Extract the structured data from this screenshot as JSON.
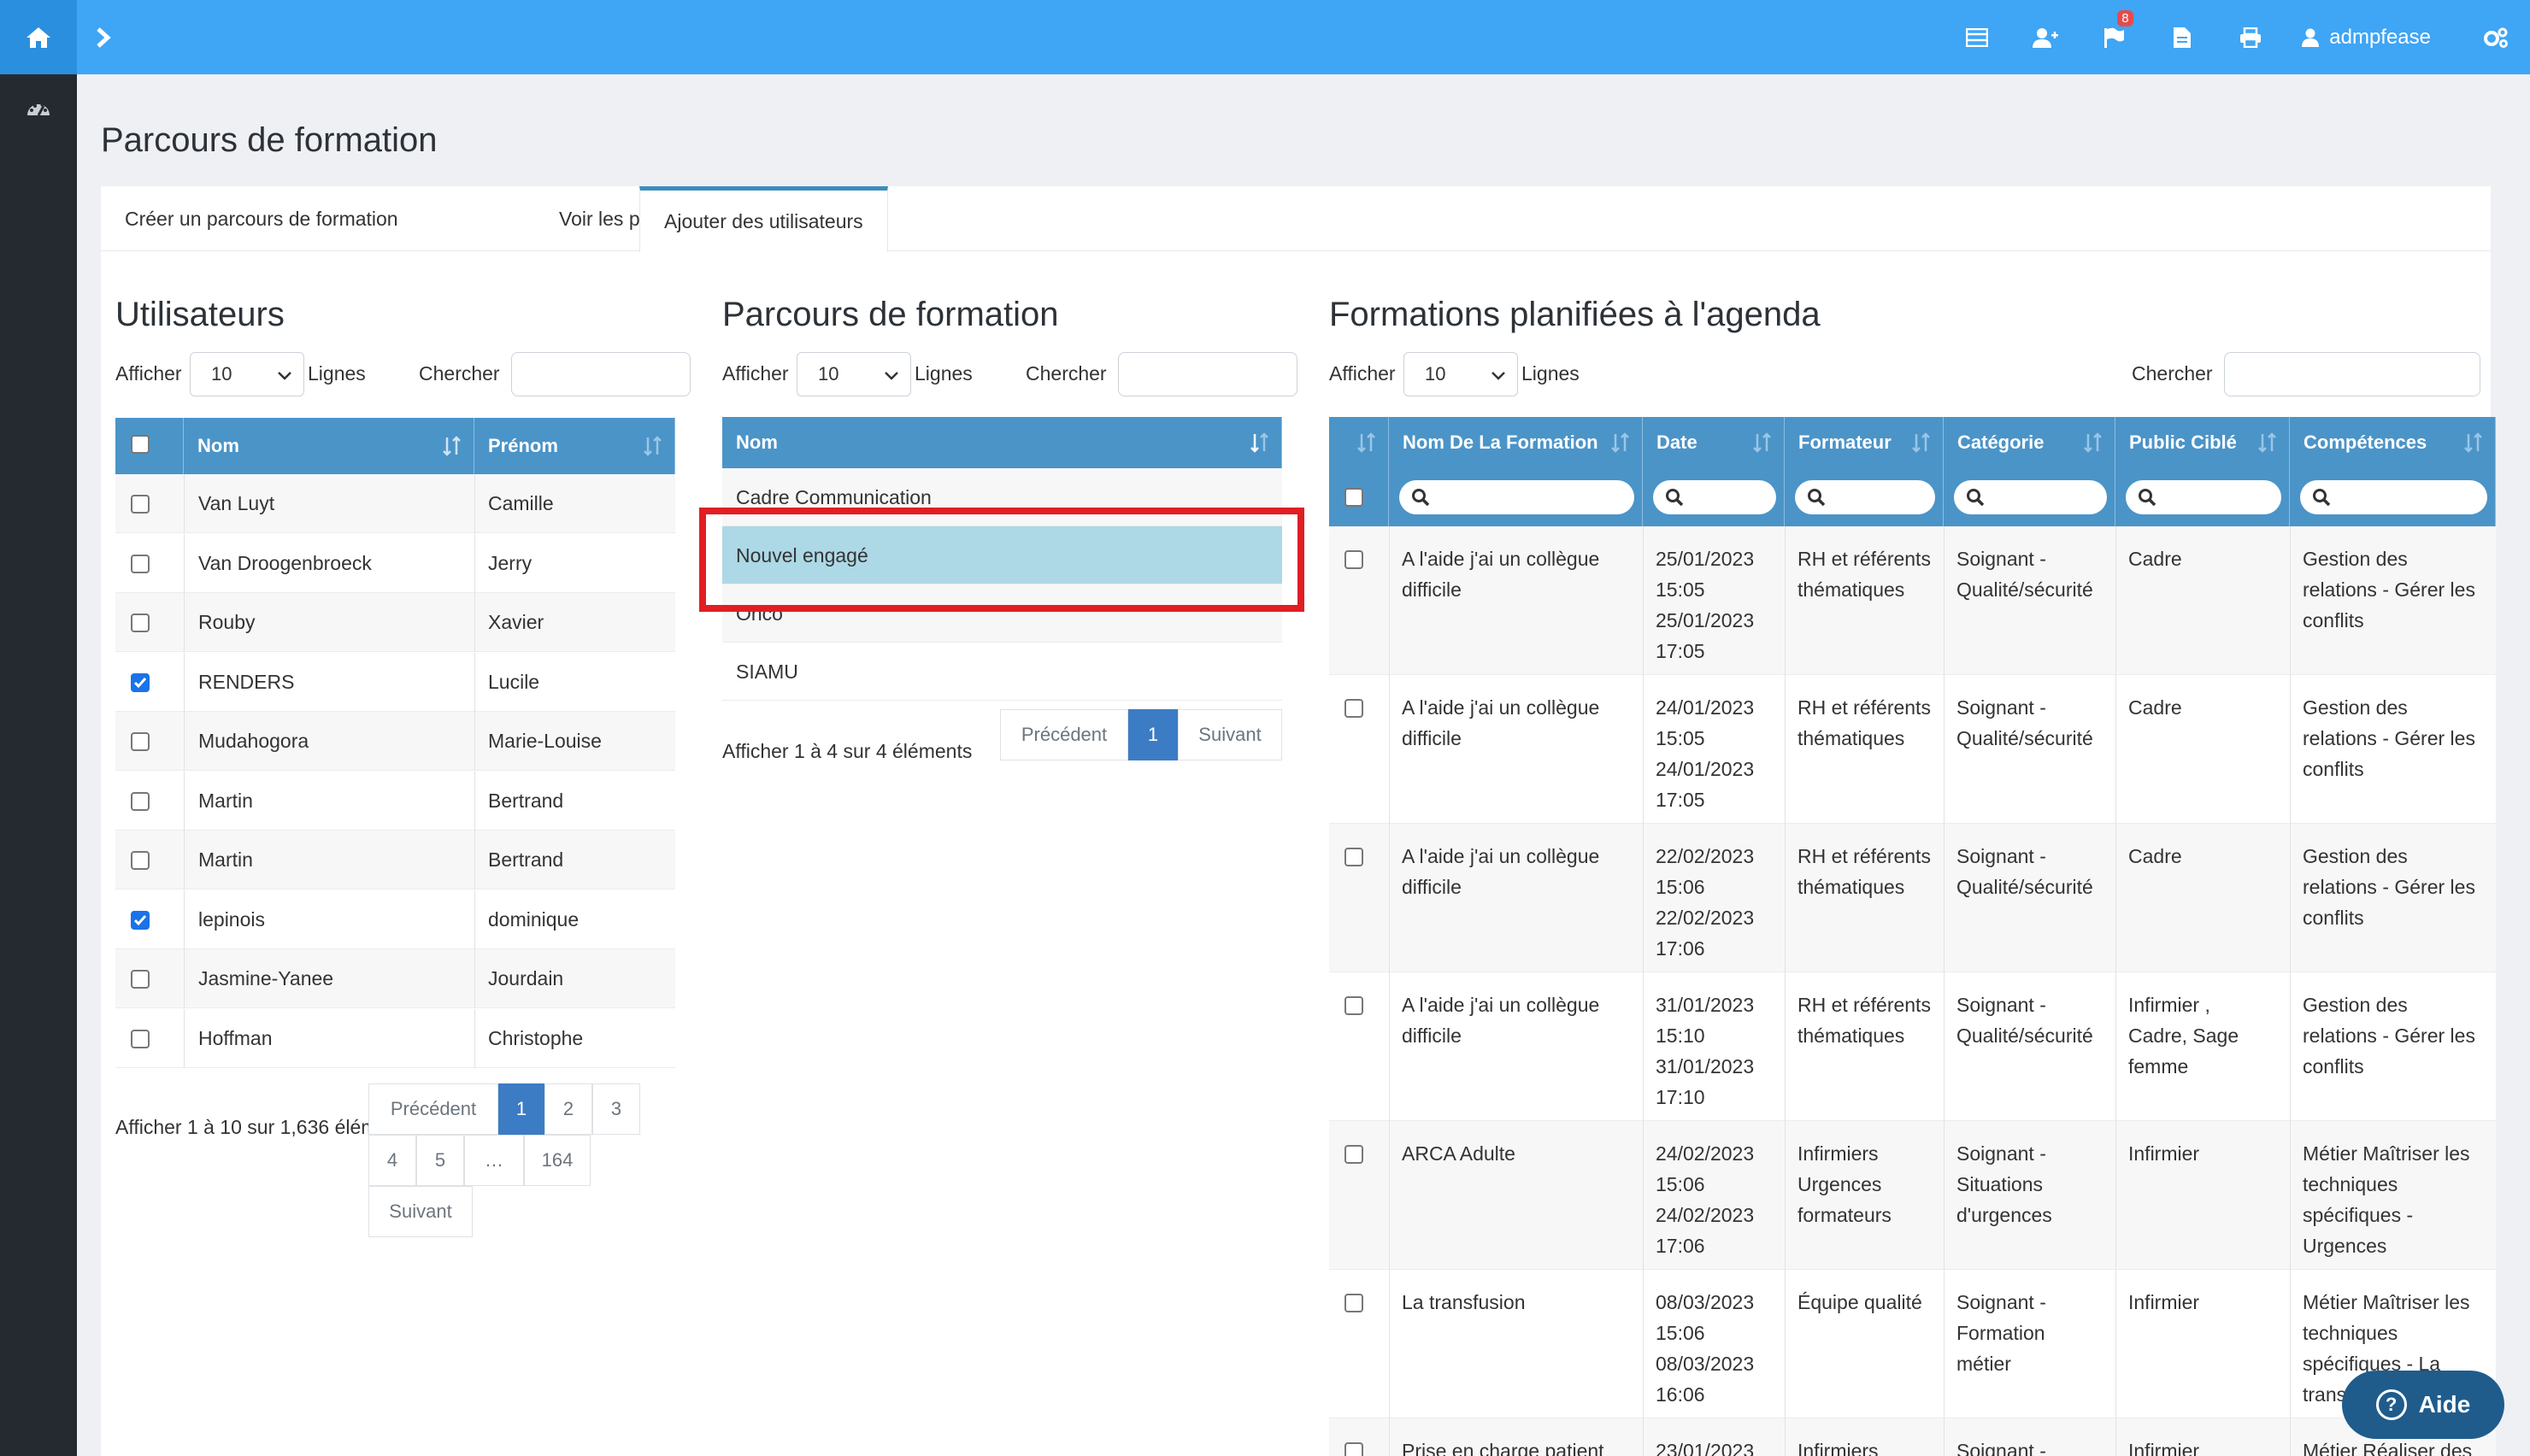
{
  "topbar": {
    "username": "admpfease",
    "notification_count": "8",
    "accent_color": "#3fa5f5",
    "icons": [
      "list-icon",
      "add-user-icon",
      "flag-icon",
      "document-icon",
      "print-icon",
      "user-icon",
      "gears-icon"
    ]
  },
  "page": {
    "title": "Parcours de formation"
  },
  "tabs": [
    {
      "label": "Créer un parcours de formation"
    },
    {
      "label": "Voir les parcours"
    },
    {
      "label": "Ajouter des utilisateurs"
    }
  ],
  "users": {
    "title": "Utilisateurs",
    "show_label": "Afficher",
    "page_size": "10",
    "rows_label": "Lignes",
    "search_label": "Chercher",
    "columns": {
      "name": "Nom",
      "firstname": "Prénom"
    },
    "rows": [
      {
        "name": "Van Luyt",
        "firstname": "Camille",
        "checked": false
      },
      {
        "name": "Van Droogenbroeck",
        "firstname": "Jerry",
        "checked": false
      },
      {
        "name": "Rouby",
        "firstname": "Xavier",
        "checked": false
      },
      {
        "name": "RENDERS",
        "firstname": "Lucile",
        "checked": true
      },
      {
        "name": "Mudahogora",
        "firstname": "Marie-Louise",
        "checked": false
      },
      {
        "name": "Martin",
        "firstname": "Bertrand",
        "checked": false
      },
      {
        "name": "Martin",
        "firstname": "Bertrand",
        "checked": false
      },
      {
        "name": "lepinois",
        "firstname": "dominique",
        "checked": true
      },
      {
        "name": "Jasmine-Yanee",
        "firstname": "Jourdain",
        "checked": false
      },
      {
        "name": "Hoffman",
        "firstname": "Christophe",
        "checked": false
      }
    ],
    "info": "Afficher 1 à 10 sur 1,636 élém",
    "pager": {
      "prev": "Précédent",
      "p1": "1",
      "p2": "2",
      "p3": "3",
      "p4": "4",
      "p5": "5",
      "ellipsis": "…",
      "last": "164",
      "next": "Suivant"
    }
  },
  "parcours": {
    "title": "Parcours de formation",
    "show_label": "Afficher",
    "page_size": "10",
    "rows_label": "Lignes",
    "search_label": "Chercher",
    "column": "Nom",
    "rows": [
      "Cadre Communication",
      "Nouvel engagé",
      "Onco",
      "SIAMU"
    ],
    "selected_index": 1,
    "info": "Afficher 1 à 4 sur 4 éléments",
    "pager": {
      "prev": "Précédent",
      "p1": "1",
      "next": "Suivant"
    }
  },
  "formations": {
    "title": "Formations planifiées à l'agenda",
    "show_label": "Afficher",
    "page_size": "10",
    "rows_label": "Lignes",
    "search_label": "Chercher",
    "columns": {
      "name": "Nom De La Formation",
      "date": "Date",
      "trainer": "Formateur",
      "category": "Catégorie",
      "public": "Public Ciblé",
      "skills": "Compétences"
    },
    "rows": [
      {
        "name": [
          "A l'aide j'ai un collègue",
          "difficile"
        ],
        "date": [
          "25/01/2023",
          "15:05",
          "25/01/2023",
          "17:05"
        ],
        "trainer": [
          "RH et référents",
          "thématiques"
        ],
        "category": [
          "Soignant -",
          "Qualité/sécurité"
        ],
        "public": [
          "Cadre"
        ],
        "skills": [
          "Gestion des",
          "relations - Gérer les",
          "conflits"
        ]
      },
      {
        "name": [
          "A l'aide j'ai un collègue",
          "difficile"
        ],
        "date": [
          "24/01/2023",
          "15:05",
          "24/01/2023",
          "17:05"
        ],
        "trainer": [
          "RH et référents",
          "thématiques"
        ],
        "category": [
          "Soignant -",
          "Qualité/sécurité"
        ],
        "public": [
          "Cadre"
        ],
        "skills": [
          "Gestion des",
          "relations - Gérer les",
          "conflits"
        ]
      },
      {
        "name": [
          "A l'aide j'ai un collègue",
          "difficile"
        ],
        "date": [
          "22/02/2023",
          "15:06",
          "22/02/2023",
          "17:06"
        ],
        "trainer": [
          "RH et référents",
          "thématiques"
        ],
        "category": [
          "Soignant -",
          "Qualité/sécurité"
        ],
        "public": [
          "Cadre"
        ],
        "skills": [
          "Gestion des",
          "relations - Gérer les",
          "conflits"
        ]
      },
      {
        "name": [
          "A l'aide j'ai un collègue",
          "difficile"
        ],
        "date": [
          "31/01/2023",
          "15:10",
          "31/01/2023",
          "17:10"
        ],
        "trainer": [
          "RH et référents",
          "thématiques"
        ],
        "category": [
          "Soignant -",
          "Qualité/sécurité"
        ],
        "public": [
          "Infirmier ,",
          "Cadre, Sage",
          "femme"
        ],
        "skills": [
          "Gestion des",
          "relations - Gérer les",
          "conflits"
        ]
      },
      {
        "name": [
          "ARCA Adulte"
        ],
        "date": [
          "24/02/2023",
          "15:06",
          "24/02/2023",
          "17:06"
        ],
        "trainer": [
          "Infirmiers",
          "Urgences",
          "formateurs"
        ],
        "category": [
          "Soignant -",
          "Situations",
          "d'urgences"
        ],
        "public": [
          "Infirmier"
        ],
        "skills": [
          "Métier Maîtriser les",
          "techniques",
          "spécifiques -",
          "Urgences"
        ]
      },
      {
        "name": [
          "La transfusion"
        ],
        "date": [
          "08/03/2023",
          "15:06",
          "08/03/2023",
          "16:06"
        ],
        "trainer": [
          "Équipe qualité"
        ],
        "category": [
          "Soignant -",
          "Formation",
          "métier"
        ],
        "public": [
          "Infirmier"
        ],
        "skills": [
          "Métier Maîtriser les",
          "techniques",
          "spécifiques - La",
          "trans"
        ]
      },
      {
        "name": [
          "Prise en charge patient"
        ],
        "date": [
          "23/01/2023"
        ],
        "trainer": [
          "Infirmiers"
        ],
        "category": [
          "Soignant -"
        ],
        "public": [
          "Infirmier"
        ],
        "skills": [
          "Métier Réaliser des"
        ]
      }
    ]
  },
  "help": {
    "label": "Aide"
  }
}
